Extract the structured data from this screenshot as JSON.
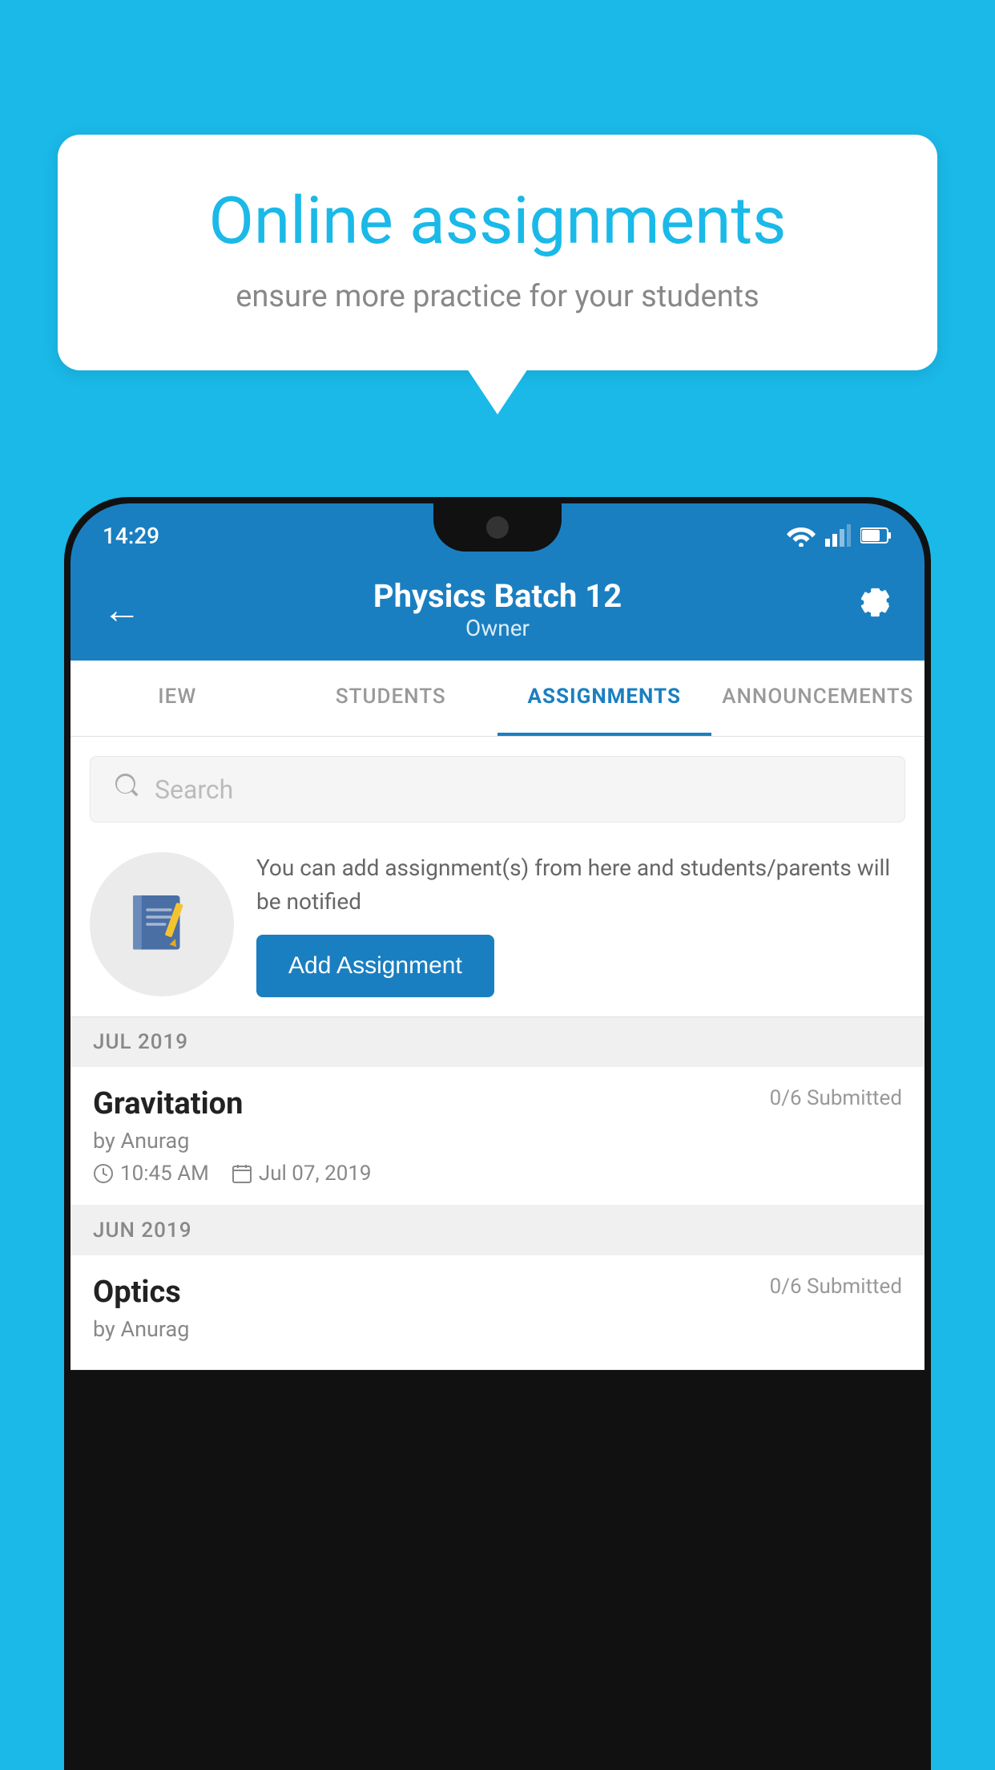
{
  "background_color": "#1ab9e8",
  "speech_bubble": {
    "title": "Online assignments",
    "subtitle": "ensure more practice for your students"
  },
  "status_bar": {
    "time": "14:29"
  },
  "app_header": {
    "title": "Physics Batch 12",
    "subtitle": "Owner",
    "back_label": "←",
    "gear_label": "⚙"
  },
  "tabs": [
    {
      "label": "IEW",
      "active": false
    },
    {
      "label": "STUDENTS",
      "active": false
    },
    {
      "label": "ASSIGNMENTS",
      "active": true
    },
    {
      "label": "ANNOUNCEMENTS",
      "active": false
    }
  ],
  "search": {
    "placeholder": "Search"
  },
  "add_assignment": {
    "description": "You can add assignment(s) from here and students/parents will be notified",
    "button_label": "Add Assignment"
  },
  "sections": [
    {
      "label": "JUL 2019",
      "items": [
        {
          "name": "Gravitation",
          "submitted": "0/6 Submitted",
          "author": "by Anurag",
          "time": "10:45 AM",
          "date": "Jul 07, 2019"
        }
      ]
    },
    {
      "label": "JUN 2019",
      "items": [
        {
          "name": "Optics",
          "submitted": "0/6 Submitted",
          "author": "by Anurag",
          "time": "",
          "date": ""
        }
      ]
    }
  ]
}
